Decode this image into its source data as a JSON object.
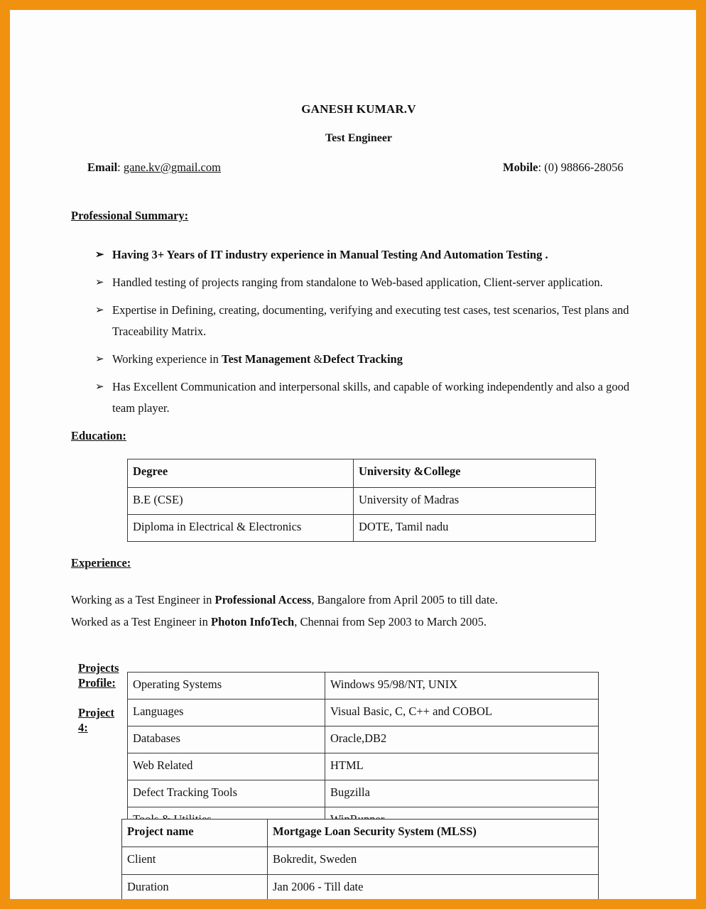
{
  "document": {
    "header": {
      "name": "GANESH KUMAR.V",
      "role": "Test Engineer",
      "email_label": "Email",
      "email_separator": ": ",
      "email_value": "gane.kv@gmail.com",
      "mobile_label": "Mobile",
      "mobile_separator": ":  ",
      "mobile_value": "(0) 98866-28056"
    },
    "sections": {
      "professional_summary_heading": "Professional Summary:",
      "education_heading": "Education: ",
      "experience_heading": "Experience:"
    },
    "summary_bullets": [
      {
        "marker": "➢",
        "bold": true,
        "text_before": "Having 3+ Years of IT industry experience in Manual Testing And Automation Testing",
        "text_bold": "",
        "text_after": " ."
      },
      {
        "marker": "➢",
        "bold": false,
        "text_before": "Handled testing of projects ranging from standalone to Web-based application, Client-server application.",
        "text_bold": "",
        "text_after": ""
      },
      {
        "marker": "➢",
        "bold": false,
        "text_before": "Expertise in Defining, creating, documenting, verifying and executing test cases, test scenarios, Test plans and Traceability Matrix.",
        "text_bold": "",
        "text_after": ""
      },
      {
        "marker": "➢",
        "bold": false,
        "text_before": "Working experience in ",
        "text_bold": "Test Management",
        "text_mid": " &",
        "text_bold2": "Defect Tracking",
        "text_after": ""
      },
      {
        "marker": "➢",
        "bold": false,
        "text_before": "Has Excellent Communication and interpersonal skills, and capable of working independently and also a good team player.",
        "text_bold": "",
        "text_after": ""
      }
    ],
    "education_table": {
      "headers": [
        "Degree",
        "University &College"
      ],
      "rows": [
        [
          "B.E  (CSE)",
          "University of Madras"
        ],
        [
          "Diploma in Electrical & Electronics",
          "DOTE, Tamil nadu"
        ]
      ]
    },
    "experience_lines": [
      {
        "before": "Working as a Test Engineer in ",
        "bold": "Professional Access",
        "after": ", Bangalore from April 2005 to till date."
      },
      {
        "before": "Worked as a Test Engineer in ",
        "bold": "Photon InfoTech",
        "after": ", Chennai from Sep 2003 to March 2005."
      }
    ],
    "projects_side_headings": [
      "Projects Profile:",
      "Project 4:"
    ],
    "skills_table": {
      "rows": [
        [
          "Operating Systems",
          "Windows 95/98/NT, UNIX"
        ],
        [
          "Languages",
          "Visual Basic, C, C++ and COBOL"
        ],
        [
          "Databases",
          "Oracle,DB2"
        ],
        [
          "Web Related",
          "HTML"
        ],
        [
          "Defect Tracking Tools",
          "Bugzilla"
        ],
        [
          "Tools & Utilities",
          "WinRunner"
        ]
      ]
    },
    "project_table": {
      "header_row": [
        "Project name",
        "Mortgage Loan Security System (MLSS)"
      ],
      "rows": [
        [
          "Client",
          "Bokredit, Sweden"
        ],
        [
          "Duration",
          "Jan 2006 - Till date"
        ]
      ]
    },
    "watermark": "",
    "colors": {
      "page_border": "#f0920f",
      "text": "#111111",
      "table_border": "#3a3a3a"
    }
  }
}
